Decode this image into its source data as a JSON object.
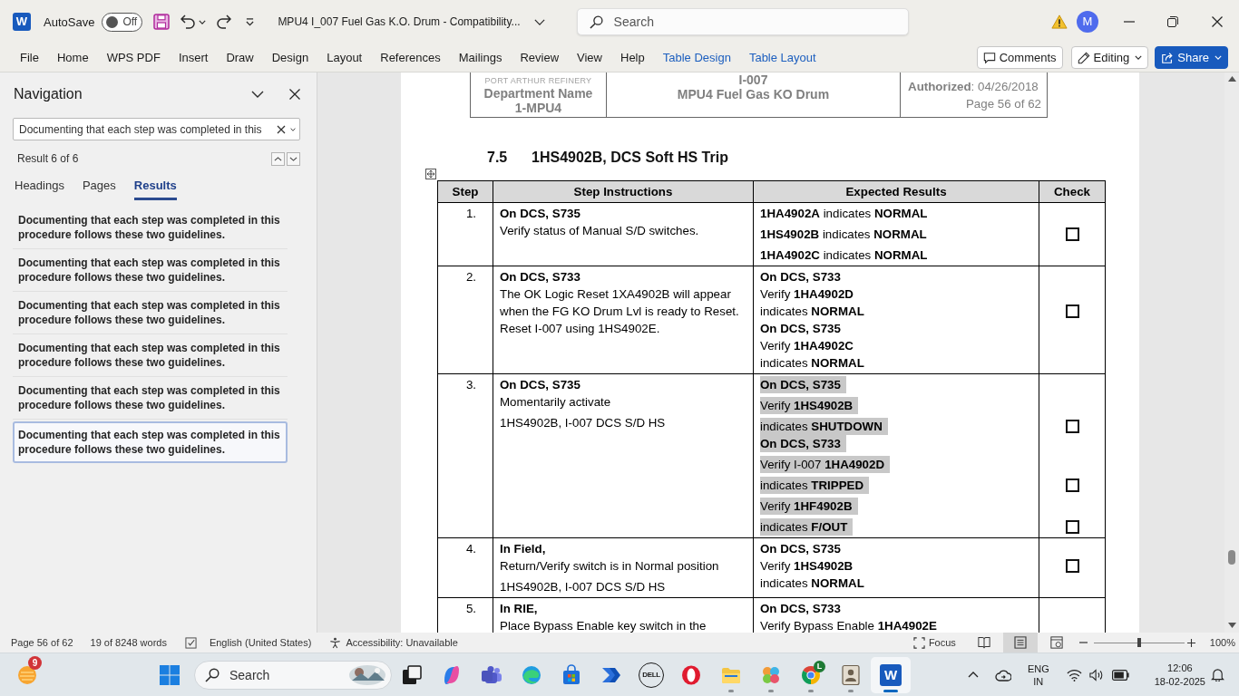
{
  "title_bar": {
    "logo": "W",
    "autosave_label": "AutoSave",
    "autosave": {
      "on": false,
      "label": "Off"
    },
    "document_title": "MPU4 I_007 Fuel Gas K.O. Drum - Compatibility...",
    "search_placeholder": "Search",
    "account_initial": "M"
  },
  "ribbon": {
    "tabs": [
      {
        "label": "File",
        "kind": "standard",
        "selected": false
      },
      {
        "label": "Home",
        "kind": "standard",
        "selected": false
      },
      {
        "label": "WPS PDF",
        "kind": "standard",
        "selected": false
      },
      {
        "label": "Insert",
        "kind": "standard",
        "selected": false
      },
      {
        "label": "Draw",
        "kind": "standard",
        "selected": false
      },
      {
        "label": "Design",
        "kind": "standard",
        "selected": false
      },
      {
        "label": "Layout",
        "kind": "standard",
        "selected": false
      },
      {
        "label": "References",
        "kind": "standard",
        "selected": false
      },
      {
        "label": "Mailings",
        "kind": "standard",
        "selected": false
      },
      {
        "label": "Review",
        "kind": "standard",
        "selected": false
      },
      {
        "label": "View",
        "kind": "standard",
        "selected": false
      },
      {
        "label": "Help",
        "kind": "standard",
        "selected": false
      },
      {
        "label": "Table Design",
        "kind": "contextual",
        "selected": false
      },
      {
        "label": "Table Layout",
        "kind": "contextual",
        "selected": false
      }
    ],
    "comments": "Comments",
    "editing": "Editing",
    "share": "Share"
  },
  "navigation": {
    "title": "Navigation",
    "search_value": "Documenting that each step was completed in this",
    "result_count": "Result 6 of 6",
    "tabs": [
      {
        "label": "Headings",
        "selected": false
      },
      {
        "label": "Pages",
        "selected": false
      },
      {
        "label": "Results",
        "selected": true
      }
    ],
    "results": [
      {
        "text": "Documenting that each step was completed in this procedure follows these two guidelines.",
        "selected": false
      },
      {
        "text": "Documenting that each step was completed in this procedure follows these two guidelines.",
        "selected": false
      },
      {
        "text": "Documenting that each step was completed in this procedure follows these two guidelines.",
        "selected": false
      },
      {
        "text": "Documenting that each step was completed in this procedure follows these two guidelines.",
        "selected": false
      },
      {
        "text": "Documenting that each step was completed in this procedure follows these two guidelines.",
        "selected": false
      },
      {
        "text": "Documenting that each step was completed in this procedure follows these two guidelines.",
        "selected": true
      }
    ]
  },
  "document": {
    "header": {
      "company": "PORT ARTHUR REFINERY",
      "department": "Department Name",
      "unit": "1-MPU4",
      "procedure_id": "I-007",
      "procedure_title": "MPU4 Fuel Gas KO Drum",
      "authorized": "**Authorized**: 04/26/2018",
      "page": "Page 56 of 62"
    },
    "section_number": "7.5",
    "section_title": "1HS4902B, DCS Soft HS Trip",
    "table": {
      "columns": [
        "Step",
        "Step Instructions",
        "Expected Results",
        "Check"
      ],
      "rows": [
        {
          "step": "1.",
          "instructions": [
            [
              {
                "kind": "heading",
                "text": "On DCS, S735"
              },
              {
                "kind": "text",
                "text": "Verify status of Manual S/D switches."
              }
            ]
          ],
          "results": {
            "highlighted": false,
            "paragraphs": [
              [
                {
                  "kind": "text",
                  "text": "**1HA4902A** indicates **NORMAL**"
                }
              ],
              [
                {
                  "kind": "text",
                  "text": "**1HS4902B** indicates **NORMAL**",
                  "checked": false
                }
              ],
              [
                {
                  "kind": "text",
                  "text": "**1HA4902C** indicates **NORMAL**"
                }
              ]
            ]
          }
        },
        {
          "step": "2.",
          "instructions": [
            [
              {
                "kind": "heading",
                "text": "On DCS, S733"
              },
              {
                "kind": "text",
                "text": "The OK Logic Reset 1XA4902B will appear when the FG KO Drum Lvl is ready to Reset. Reset I-007 using 1HS4902E."
              }
            ]
          ],
          "results": {
            "highlighted": false,
            "paragraphs": [
              [
                {
                  "kind": "heading",
                  "text": "On DCS, S733"
                },
                {
                  "kind": "text",
                  "text": "Verify **1HA4902D**"
                },
                {
                  "kind": "text",
                  "text": "indicates **NORMAL**",
                  "checked": false
                },
                {
                  "kind": "heading",
                  "text": "On DCS, S735"
                },
                {
                  "kind": "text",
                  "text": "Verify **1HA4902C**"
                },
                {
                  "kind": "text",
                  "text": "indicates **NORMAL**"
                }
              ]
            ]
          }
        },
        {
          "step": "3.",
          "instructions": [
            [
              {
                "kind": "heading",
                "text": "On DCS, S735"
              },
              {
                "kind": "text",
                "text": "Momentarily activate"
              }
            ],
            [
              {
                "kind": "text",
                "text": "1HS4902B, I-007 DCS S/D HS"
              }
            ]
          ],
          "results": {
            "highlighted": true,
            "paragraphs": [
              [
                {
                  "kind": "heading",
                  "text": "On DCS, S735"
                }
              ],
              [
                {
                  "kind": "text",
                  "text": "Verify **1HS4902B**"
                }
              ],
              [
                {
                  "kind": "text",
                  "text": "indicates **SHUTDOWN**",
                  "checked": false
                },
                {
                  "kind": "heading",
                  "text": "On DCS, S733"
                }
              ],
              [
                {
                  "kind": "text",
                  "text": "Verify I-007 **1HA4902D**"
                }
              ],
              [
                {
                  "kind": "text",
                  "text": "indicates **TRIPPED**",
                  "checked": false
                }
              ],
              [
                {
                  "kind": "text",
                  "text": "Verify **1HF4902B**"
                }
              ],
              [
                {
                  "kind": "text",
                  "text": "indicates **F/OUT**",
                  "checked": false
                }
              ]
            ]
          }
        },
        {
          "step": "4.",
          "instructions": [
            [
              {
                "kind": "heading",
                "text": "In Field,"
              },
              {
                "kind": "text",
                "text": "Return/Verify switch is in Normal position"
              }
            ],
            [
              {
                "kind": "text",
                "text": "1HS4902B, I-007 DCS S/D HS"
              }
            ]
          ],
          "results": {
            "highlighted": false,
            "paragraphs": [
              [
                {
                  "kind": "heading",
                  "text": "On DCS, S735"
                },
                {
                  "kind": "text",
                  "text": "Verify **1HS4902B**",
                  "checked": false
                },
                {
                  "kind": "text",
                  "text": "indicates **NORMAL**"
                }
              ]
            ]
          }
        },
        {
          "step": "5.",
          "instructions": [
            [
              {
                "kind": "heading",
                "text": "In RIE,"
              },
              {
                "kind": "text",
                "text": "Place Bypass Enable key switch in the"
              }
            ]
          ],
          "results": {
            "highlighted": false,
            "paragraphs": [
              [
                {
                  "kind": "heading",
                  "text": "On DCS, S733"
                },
                {
                  "kind": "text",
                  "text": "Verify Bypass Enable **1HA4902E**"
                }
              ]
            ]
          }
        }
      ]
    }
  },
  "status_bar": {
    "page": "Page 56 of 62",
    "words": "19 of 8248 words",
    "language": "English (United States)",
    "accessibility": "Accessibility: Unavailable",
    "focus": "Focus",
    "views": [
      {
        "kind": "read",
        "selected": false
      },
      {
        "kind": "print",
        "selected": true
      },
      {
        "kind": "web",
        "selected": false
      }
    ],
    "zoom": {
      "level": 0.5,
      "label": "100%"
    }
  },
  "taskbar": {
    "widgets": {
      "badge": "9"
    },
    "search_placeholder": "Search",
    "apps": [
      {
        "kind": "task_view",
        "running": false,
        "selected": false
      },
      {
        "kind": "copilot",
        "running": false,
        "selected": false
      },
      {
        "kind": "teams",
        "running": false,
        "selected": false
      },
      {
        "kind": "edge",
        "running": false,
        "selected": false
      },
      {
        "kind": "store",
        "running": false,
        "selected": false
      },
      {
        "kind": "automate",
        "running": false,
        "selected": false
      },
      {
        "kind": "dell",
        "label": "DELL",
        "running": false,
        "selected": false
      },
      {
        "kind": "opera",
        "running": false,
        "selected": false
      },
      {
        "kind": "explorer",
        "running": true,
        "selected": false
      },
      {
        "kind": "paint",
        "running": true,
        "selected": false
      },
      {
        "kind": "chrome",
        "badge": "L",
        "running": true,
        "selected": false
      },
      {
        "kind": "viewer",
        "running": true,
        "selected": false
      },
      {
        "kind": "word",
        "label": "W",
        "running": true,
        "selected": true
      }
    ],
    "tray": {
      "language": "ENG",
      "region": "IN",
      "time": "12:06",
      "date": "18-02-2025"
    }
  }
}
